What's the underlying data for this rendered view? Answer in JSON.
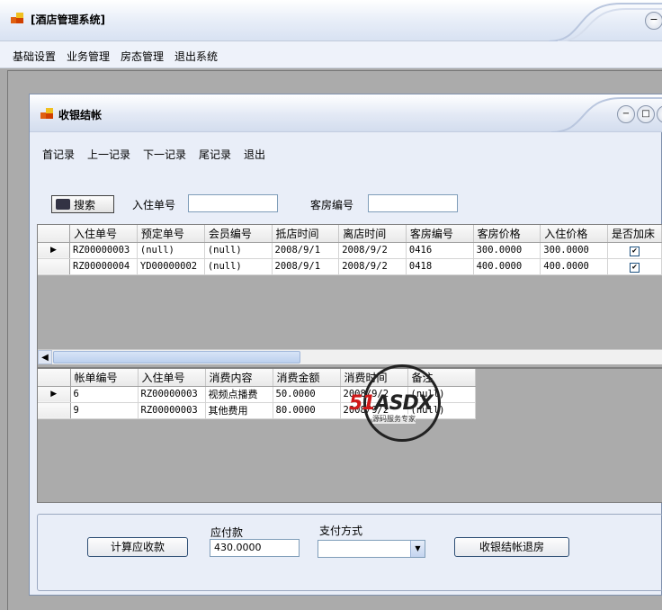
{
  "main_window": {
    "title": "[酒店管理系统]",
    "menu": [
      "基础设置",
      "业务管理",
      "房态管理",
      "退出系统"
    ]
  },
  "child_window": {
    "title": "收银结帐",
    "menu": [
      "首记录",
      "上一记录",
      "下一记录",
      "尾记录",
      "退出"
    ],
    "search": {
      "button_label": "搜索",
      "checkin_label": "入住单号",
      "checkin_value": "",
      "room_label": "客房编号",
      "room_value": ""
    },
    "checkin_grid": {
      "columns": [
        "入住单号",
        "预定单号",
        "会员编号",
        "抵店时间",
        "离店时间",
        "客房编号",
        "客房价格",
        "入住价格",
        "是否加床"
      ],
      "rows": [
        [
          "RZ00000003",
          "(null)",
          "(null)",
          "2008/9/1",
          "2008/9/2",
          "0416",
          "300.0000",
          "300.0000",
          true
        ],
        [
          "RZ00000004",
          "YD00000002",
          "(null)",
          "2008/9/1",
          "2008/9/2",
          "0418",
          "400.0000",
          "400.0000",
          true
        ]
      ]
    },
    "bill_grid": {
      "columns": [
        "帐单编号",
        "入住单号",
        "消费内容",
        "消费金额",
        "消费时间",
        "备注"
      ],
      "rows": [
        [
          "6",
          "RZ00000003",
          "视频点播费",
          "50.0000",
          "2008/9/2",
          "(null)"
        ],
        [
          "9",
          "RZ00000003",
          "其他费用",
          "80.0000",
          "2008/9/2",
          "(null)"
        ]
      ]
    },
    "footer": {
      "calc_button": "计算应收款",
      "amount_label": "应付款",
      "amount_value": "430.0000",
      "payment_label": "支付方式",
      "payment_value": "",
      "checkout_button": "收银结帐退房"
    }
  },
  "watermark": {
    "text_red": "51",
    "text_black": "ASDX",
    "subtitle": "源码服务专家"
  }
}
